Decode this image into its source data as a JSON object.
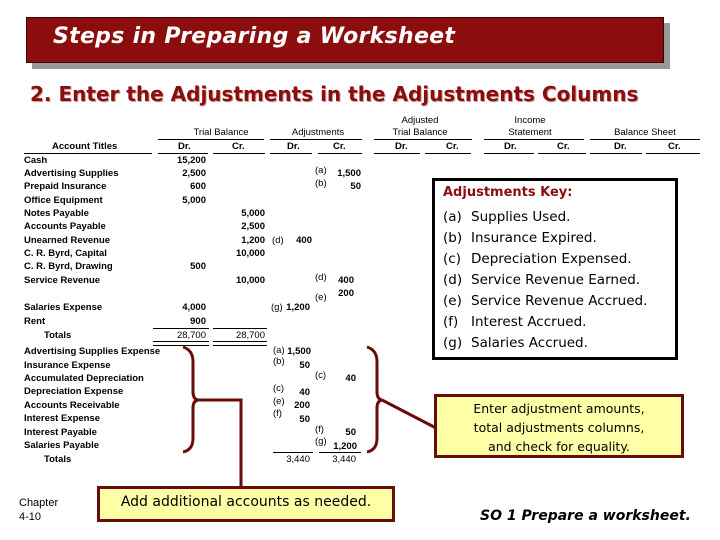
{
  "title": "Steps in Preparing a Worksheet",
  "subtitle": "2. Enter the Adjustments in the Adjustments Columns",
  "worksheet": {
    "column_groups": {
      "trial_balance": "Trial Balance",
      "adjustments": "Adjustments",
      "adjusted_tb_line1": "Adjusted",
      "adjusted_tb_line2": "Trial Balance",
      "income_line1": "Income",
      "income_line2": "Statement",
      "balance_sheet": "Balance Sheet"
    },
    "account_titles_header": "Account Titles",
    "dr": "Dr.",
    "cr": "Cr.",
    "rows": [
      {
        "account": "Cash",
        "tb_dr": "15,200",
        "tb_cr": "",
        "adj_dr": "",
        "adj_cr": ""
      },
      {
        "account": "Advertising Supplies",
        "tb_dr": "2,500",
        "tb_cr": "",
        "adj_dr": "",
        "adj_cr": "1,500",
        "adj_cr_tag": "(a)"
      },
      {
        "account": "Prepaid Insurance",
        "tb_dr": "600",
        "tb_cr": "",
        "adj_dr": "",
        "adj_cr": "50",
        "adj_cr_tag": "(b)"
      },
      {
        "account": "Office Equipment",
        "tb_dr": "5,000",
        "tb_cr": "",
        "adj_dr": "",
        "adj_cr": ""
      },
      {
        "account": "Notes Payable",
        "tb_dr": "",
        "tb_cr": "5,000",
        "adj_dr": "",
        "adj_cr": ""
      },
      {
        "account": "Accounts Payable",
        "tb_dr": "",
        "tb_cr": "2,500",
        "adj_dr": "",
        "adj_cr": ""
      },
      {
        "account": "Unearned Revenue",
        "tb_dr": "",
        "tb_cr": "1,200",
        "adj_dr": "400",
        "adj_dr_tag": "(d)",
        "adj_cr": ""
      },
      {
        "account": "C. R. Byrd, Capital",
        "tb_dr": "",
        "tb_cr": "10,000",
        "adj_dr": "",
        "adj_cr": ""
      },
      {
        "account": "C. R. Byrd, Drawing",
        "tb_dr": "500",
        "tb_cr": "",
        "adj_dr": "",
        "adj_cr": ""
      },
      {
        "account": "Service Revenue",
        "tb_dr": "",
        "tb_cr": "10,000",
        "adj_dr": "",
        "adj_cr": "400",
        "adj_cr_tag": "(d)",
        "adj_cr2": "200",
        "adj_cr2_tag": "(e)"
      },
      {
        "account": "Salaries Expense",
        "tb_dr": "4,000",
        "tb_cr": "",
        "adj_dr": "1,200",
        "adj_dr_tag": "(g)",
        "adj_cr": ""
      },
      {
        "account": "Rent",
        "tb_dr": "900",
        "tb_cr": "",
        "adj_dr": "",
        "adj_cr": ""
      }
    ],
    "totals_label": "Totals",
    "tb_totals": {
      "dr": "28,700",
      "cr": "28,700"
    },
    "added_rows": [
      {
        "account": "Advertising Supplies Expense",
        "adj_dr": "1,500",
        "adj_dr_tag": "(a)",
        "adj_cr": ""
      },
      {
        "account": "Insurance Expense",
        "adj_dr": "50",
        "adj_dr_tag": "(b)",
        "adj_cr": ""
      },
      {
        "account": "Accumulated Depreciation",
        "adj_dr": "",
        "adj_cr": "40",
        "adj_cr_tag": "(c)"
      },
      {
        "account": "Depreciation Expense",
        "adj_dr": "40",
        "adj_dr_tag": "(c)",
        "adj_cr": ""
      },
      {
        "account": "Accounts Receivable",
        "adj_dr": "200",
        "adj_dr_tag": "(e)",
        "adj_cr": ""
      },
      {
        "account": "Interest Expense",
        "adj_dr": "50",
        "adj_dr_tag": "(f)",
        "adj_cr": ""
      },
      {
        "account": "Interest Payable",
        "adj_dr": "",
        "adj_cr": "50",
        "adj_cr_tag": "(f)"
      },
      {
        "account": "Salaries Payable",
        "adj_dr": "",
        "adj_cr": "1,200",
        "adj_cr_tag": "(g)"
      }
    ],
    "adj_totals": {
      "dr": "3,440",
      "cr": "3,440"
    }
  },
  "adjustments_key": {
    "title": "Adjustments Key:",
    "items": [
      {
        "letter": "(a)",
        "text": "Supplies Used."
      },
      {
        "letter": "(b)",
        "text": "Insurance Expired."
      },
      {
        "letter": "(c)",
        "text": "Depreciation Expensed."
      },
      {
        "letter": "(d)",
        "text": "Service Revenue Earned."
      },
      {
        "letter": "(e)",
        "text": "Service Revenue Accrued."
      },
      {
        "letter": "(f)",
        "text": "Interest Accrued."
      },
      {
        "letter": "(g)",
        "text": "Salaries Accrued."
      }
    ]
  },
  "notes": {
    "enter_adjustments": [
      "Enter adjustment amounts,",
      "total adjustments columns,",
      "and check for equality."
    ],
    "add_accounts": "Add additional accounts as needed."
  },
  "footer": {
    "chapter_label": "Chapter",
    "page": "4-10",
    "study_objective": "SO 1   Prepare a worksheet."
  },
  "colors": {
    "title_bg": "#8b0d0d",
    "subtitle": "#8b0d0d",
    "note_bg": "#ffffa8",
    "note_border": "#6b0c0c",
    "bracket": "#6b0c0c"
  }
}
